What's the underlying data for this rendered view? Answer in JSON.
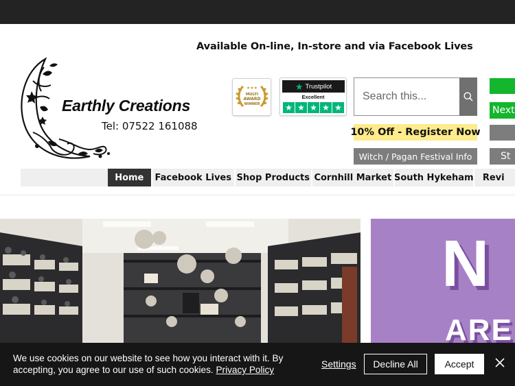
{
  "header": {
    "tagline": "Available On-line, In-store and via Facebook Lives",
    "brand_name": "Earthly Creations",
    "phone": "Tel: 07522 161088"
  },
  "badges": {
    "award_text": [
      "MULTI",
      "AWARD",
      "WINNER"
    ],
    "trustpilot": {
      "brand": "Trustpilot",
      "rating_word": "Excellent",
      "stars": 5
    }
  },
  "search": {
    "placeholder": "Search this..."
  },
  "buttons": {
    "promo": "10% Off - Register Now",
    "festival": "Witch / Pagan Festival Info",
    "next": "Next",
    "st": "St"
  },
  "nav": {
    "items": [
      {
        "label": "Home",
        "active": true
      },
      {
        "label": "Facebook Lives",
        "active": false
      },
      {
        "label": "Shop Products",
        "active": false
      },
      {
        "label": "Cornhill Market",
        "active": false
      },
      {
        "label": "South Hykeham",
        "active": false
      },
      {
        "label": "Revi",
        "active": false
      }
    ]
  },
  "promo_image": {
    "big_letter": "N",
    "word": "ARE"
  },
  "cookie": {
    "text": "We use cookies on our website to see how you interact with it. By accepting, you agree to our use of such cookies.",
    "policy_link": "Privacy Policy",
    "settings": "Settings",
    "decline": "Decline All",
    "accept": "Accept"
  },
  "colors": {
    "topbar": "#232323",
    "promo_yellow": "#fdeb8c",
    "grey_button": "#7d7d7d",
    "green_button": "#13b62c",
    "nav_active": "#333333",
    "trustpilot_green": "#00b67a",
    "promo_purple": "#a781c6"
  }
}
